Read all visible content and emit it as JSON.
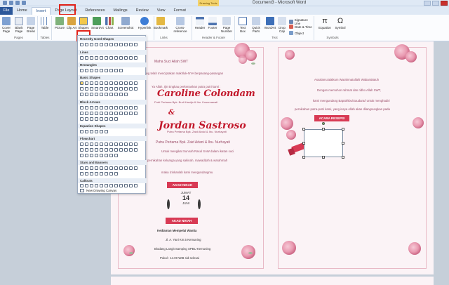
{
  "window": {
    "title": "Document3 - Microsoft Word",
    "contextual_tab_group": "Drawing Tools"
  },
  "tabs": [
    "File",
    "Home",
    "Insert",
    "Page Layout",
    "References",
    "Mailings",
    "Review",
    "View",
    "Format"
  ],
  "active_tab": "Insert",
  "ribbon": {
    "groups": {
      "pages": "Pages",
      "tables": "Tables",
      "illustrations": "Illustrations",
      "links": "Links",
      "header_footer": "Header & Footer",
      "text": "Text",
      "symbols": "Symbols"
    },
    "buttons": {
      "cover_page": "Cover Page",
      "blank_page": "Blank Page",
      "page_break": "Page Break",
      "table": "Table",
      "picture": "Picture",
      "clip_art": "Clip Art",
      "shapes": "Shapes",
      "smartart": "SmartArt",
      "chart": "Chart",
      "screenshot": "Screenshot",
      "hyperlink": "Hyperlink",
      "bookmark": "Bookmark",
      "cross_reference": "Cross-reference",
      "header": "Header",
      "footer": "Footer",
      "page_number": "Page Number",
      "text_box": "Text Box",
      "quick_parts": "Quick Parts",
      "wordart": "WordArt",
      "drop_cap": "Drop Cap",
      "signature_line": "Signature Line",
      "date_time": "Date & Time",
      "object": "Object",
      "equation": "Equation",
      "symbol": "Symbol"
    }
  },
  "shapes_dropdown": {
    "sections": [
      "Recently Used Shapes",
      "Lines",
      "Rectangles",
      "Basic Shapes",
      "Block Arrows",
      "Equation Shapes",
      "Flowchart",
      "Stars and Banners",
      "Callouts"
    ],
    "new_canvas": "New Drawing Canvas"
  },
  "document": {
    "left_page": {
      "basmallah_line": "Maha Suci Allah SWT",
      "intro_line": "yang telah menciptakan makhluk-NYA berpasang-pasangan",
      "greeting_line": "Ya Allah, Ijin Engkau perkenankan putra putri kami :",
      "bride_name": "Caroline Colondam",
      "bride_parents": "Putri Pertama Bpk. Budi Hardja & Ibu. Kusumawati",
      "ampersand": "&",
      "groom_name": "Jordan Sastroso",
      "groom_parents_a": "Putra Pertama Bpk. Zaid Abdul & Ibu. Nurhayati",
      "groom_parents_b": "Putra Pertama Bpk. Zaid Adani & Ibu. Nurhayati",
      "invite_line1": "Untuk mengikat Sunnah Rasul SAW dalam ikatan suci",
      "invite_line2": "pernikahan keluarga yang sakinah, mawaddah & warahmah",
      "invite_line3": "maka izinkanlah kami mengundangmu",
      "akad_label": "AKAD NIKAH",
      "day": "JUMAT",
      "date_num": "14",
      "month": "JUNI",
      "akad_label2": "AKAD NIKAH",
      "venue_line1": "Kediaman Mempelai Wanita",
      "venue_line2": "Jl. A. Yani Km.5 Kemuning",
      "venue_line3": "Blodang Langit Samping SPBU Kemuning",
      "time_line": "Pukul : 14.00 WIB s/d selesai"
    },
    "right_page": {
      "salam_line": "Assalamu'alaikum Warahmatullahi Wabarakatuh",
      "body_line1": "Dengan memohon rahmat dan ridho Allah SWT,",
      "body_line2": "kami mengundang Bapak/Ibu/Saudara/i untuk menghadiri",
      "body_line3": "pernikahan putra-putri kami, yang insya Allah akan dilangsungkan pada",
      "resepsi_label": "ACARA RESEPSI"
    }
  },
  "colors": {
    "file_tab": "#2b579a",
    "highlight": "#e2231a",
    "banner": "#d83a54",
    "script_text": "#c2182b",
    "page_bg": "#fbf3f6"
  }
}
